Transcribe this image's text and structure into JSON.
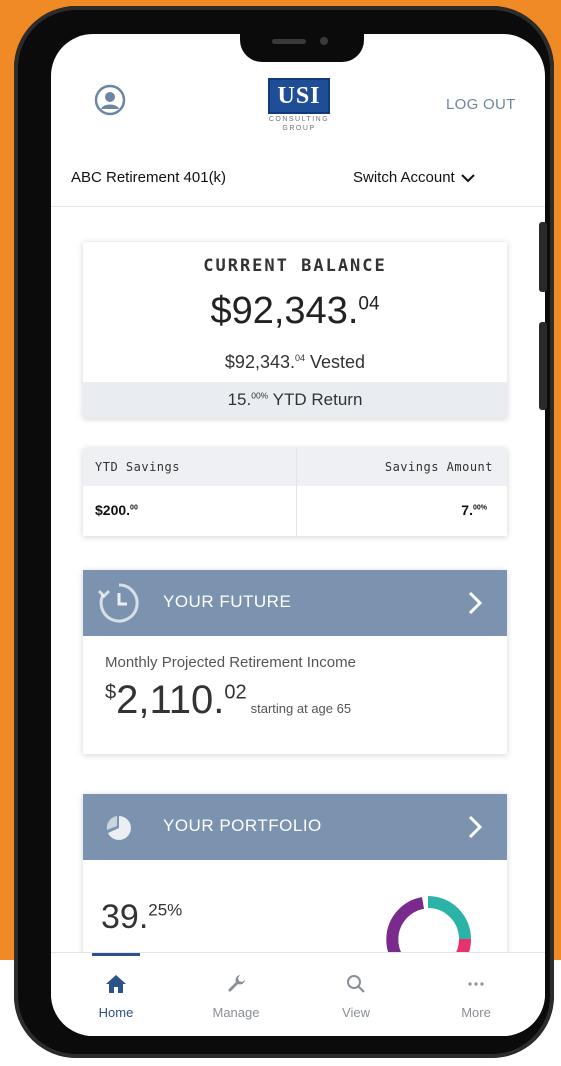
{
  "header": {
    "logo_text": "USI",
    "logo_sub1": "CONSULTING",
    "logo_sub2": "GROUP",
    "logout_label": "LOG OUT",
    "avatar_icon": "user-circle-icon"
  },
  "account": {
    "name": "ABC Retirement 401(k)",
    "switch_label": "Switch Account"
  },
  "balance": {
    "title": "CURRENT BALANCE",
    "amount_main": "$92,343.",
    "amount_cents": "04",
    "vested_main": "$92,343.",
    "vested_cents": "04",
    "vested_label": " Vested",
    "ytd_main": "15.",
    "ytd_decimal": "00%",
    "ytd_label": " YTD Return"
  },
  "savings": {
    "ytd_label": "YTD Savings",
    "amount_label": "Savings Amount",
    "ytd_main": "$200.",
    "ytd_cents": "00",
    "amount_main": "7.",
    "amount_decimal": "00%"
  },
  "future": {
    "title": "YOUR FUTURE",
    "subtitle": "Monthly Projected Retirement Income",
    "currency": "$",
    "amount_main": "2,110.",
    "amount_cents": "02",
    "age_text": "starting at age 65"
  },
  "portfolio": {
    "title": "YOUR PORTFOLIO",
    "pct_main": "39.",
    "pct_decimal": "25%",
    "donut_colors": [
      "#2bb3a8",
      "#e6336e",
      "#7a2a8c",
      "#9ac33c"
    ]
  },
  "tabs": [
    {
      "label": "Home",
      "icon": "home-icon",
      "active": true
    },
    {
      "label": "Manage",
      "icon": "wrench-icon",
      "active": false
    },
    {
      "label": "View",
      "icon": "search-icon",
      "active": false
    },
    {
      "label": "More",
      "icon": "more-dots-icon",
      "active": false
    }
  ],
  "colors": {
    "accent_blue": "#7b93ae",
    "brand_blue": "#1f4d96",
    "tab_active": "#2b5289",
    "background_orange": "#ef8a24"
  }
}
